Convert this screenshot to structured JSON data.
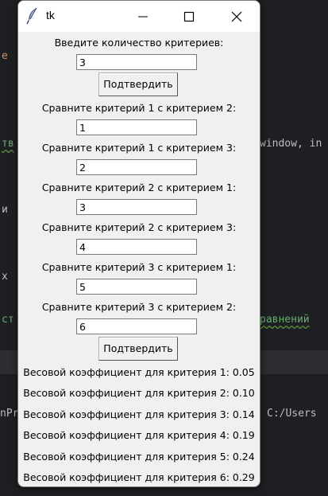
{
  "ide": {
    "fragments": {
      "f1": "е ",
      "f2": "тв",
      "f3": "window, in",
      "f4": "и ",
      "f5": "х ",
      "f6": "ст",
      "f7": "равнений",
      "f8": "nPr",
      "f9": "C:/Users"
    }
  },
  "window": {
    "title": "tk",
    "prompt_count": "Введите количество критериев:",
    "count_value": "3",
    "confirm_label": "Подтвердить",
    "comparisons": [
      {
        "label": "Сравните критерий 1 с критерием 2:",
        "value": "1"
      },
      {
        "label": "Сравните критерий 1 с критерием 3:",
        "value": "2"
      },
      {
        "label": "Сравните критерий 2 с критерием 1:",
        "value": "3"
      },
      {
        "label": "Сравните критерий 2 с критерием 3:",
        "value": "4"
      },
      {
        "label": "Сравните критерий 3 с критерием 1:",
        "value": "5"
      },
      {
        "label": "Сравните критерий 3 с критерием 2:",
        "value": "6"
      }
    ],
    "confirm2_label": "Подтвердить",
    "results": [
      "Весовой коэффициент для критерия 1: 0.05",
      "Весовой коэффициент для критерия 2: 0.10",
      "Весовой коэффициент для критерия 3: 0.14",
      "Весовой коэффициент для критерия 4: 0.19",
      "Весовой коэффициент для критерия 5: 0.24",
      "Весовой коэффициент для критерия 6: 0.29"
    ]
  }
}
